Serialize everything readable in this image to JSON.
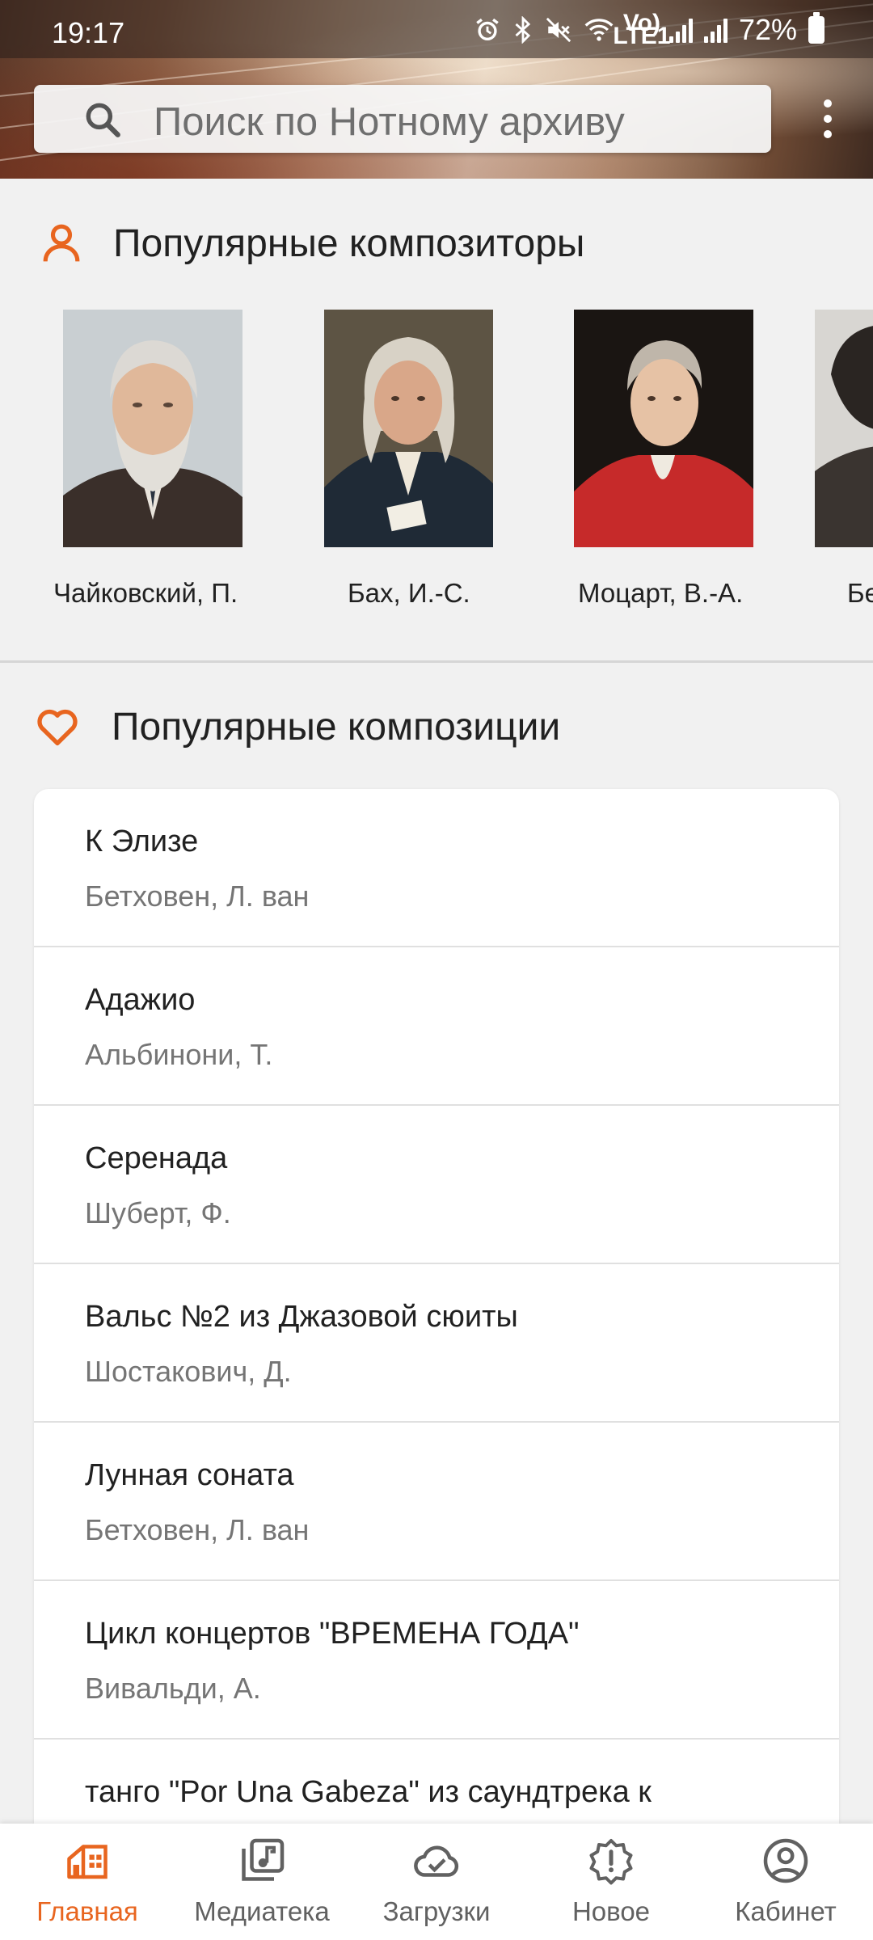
{
  "status_bar": {
    "time": "19:17",
    "battery_percent": "72%",
    "volte_label": "Vo) LTE1",
    "icons": [
      "alarm-icon",
      "bluetooth-icon",
      "mute-icon",
      "wifi-icon",
      "volte-icon",
      "signal-icon",
      "signal-icon",
      "battery-icon"
    ]
  },
  "search": {
    "placeholder": "Поиск по Нотному архиву"
  },
  "popular_composers": {
    "title": "Популярные композиторы",
    "icon": "person-icon",
    "items": [
      {
        "name": "Чайковский, П."
      },
      {
        "name": "Бах, И.-С."
      },
      {
        "name": "Моцарт, В.-А."
      },
      {
        "name": "Бе"
      }
    ]
  },
  "popular_compositions": {
    "title": "Популярные композиции",
    "icon": "heart-icon",
    "items": [
      {
        "title": "К Элизе",
        "composer": "Бетховен, Л. ван"
      },
      {
        "title": "Адажио",
        "composer": "Альбинони, Т."
      },
      {
        "title": "Серенада",
        "composer": "Шуберт, Ф."
      },
      {
        "title": "Вальс №2 из Джазовой сюиты",
        "composer": "Шостакович, Д."
      },
      {
        "title": "Лунная соната",
        "composer": "Бетховен, Л. ван"
      },
      {
        "title": "Цикл концертов \"ВРЕМЕНА ГОДА\"",
        "composer": "Вивальди, А."
      },
      {
        "title": "танго \"Por Una Gabeza\" из саундтрека к",
        "composer": ""
      }
    ]
  },
  "bottom_nav": {
    "items": [
      {
        "label": "Главная",
        "icon": "home-icon",
        "active": true
      },
      {
        "label": "Медиатека",
        "icon": "music-library-icon",
        "active": false
      },
      {
        "label": "Загрузки",
        "icon": "cloud-check-icon",
        "active": false
      },
      {
        "label": "Новое",
        "icon": "alert-badge-icon",
        "active": false
      },
      {
        "label": "Кабинет",
        "icon": "account-icon",
        "active": false
      }
    ]
  },
  "colors": {
    "accent": "#e8651f",
    "background": "#f1f1f1",
    "card": "#ffffff",
    "secondary_text": "#757575"
  }
}
